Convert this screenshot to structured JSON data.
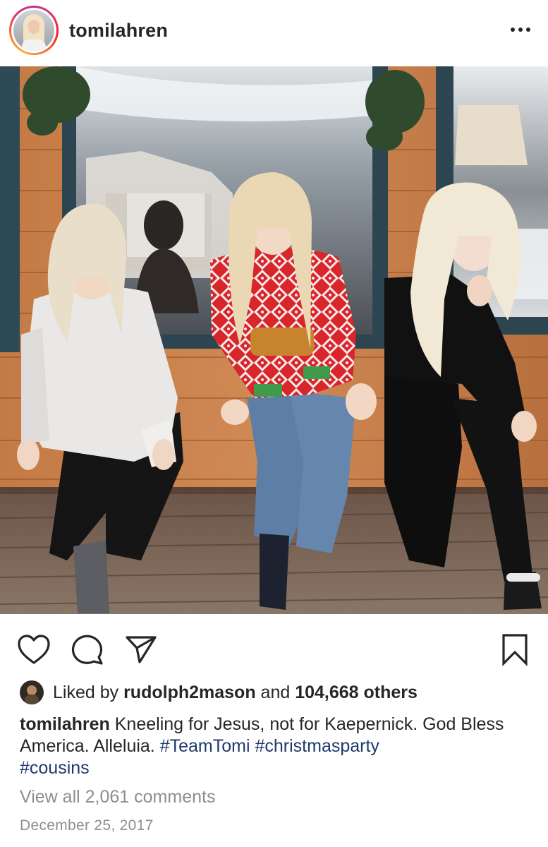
{
  "post": {
    "username": "tomilahren",
    "photo_alt": "Three women kneeling on a wooden porch",
    "likes": {
      "prefix": "Liked by",
      "user": "rudolph2mason",
      "joiner": "and",
      "count": "104,668 others"
    },
    "caption": {
      "username": "tomilahren",
      "text": "Kneeling for Jesus, not for Kaepernick. God Bless America. Alleluia.",
      "hashtags": [
        "#TeamTomi",
        "#christmasparty",
        "#cousins"
      ]
    },
    "comments_link": "View all 2,061 comments",
    "date": "December 25, 2017"
  },
  "icons": {
    "like": "heart-icon",
    "comment": "comment-icon",
    "share": "send-icon",
    "save": "bookmark-icon",
    "more": "more-options-icon"
  },
  "colors": {
    "text": "#262626",
    "muted": "#8e8e8e",
    "hashtag": "#1e3a6e",
    "background": "#ffffff"
  }
}
